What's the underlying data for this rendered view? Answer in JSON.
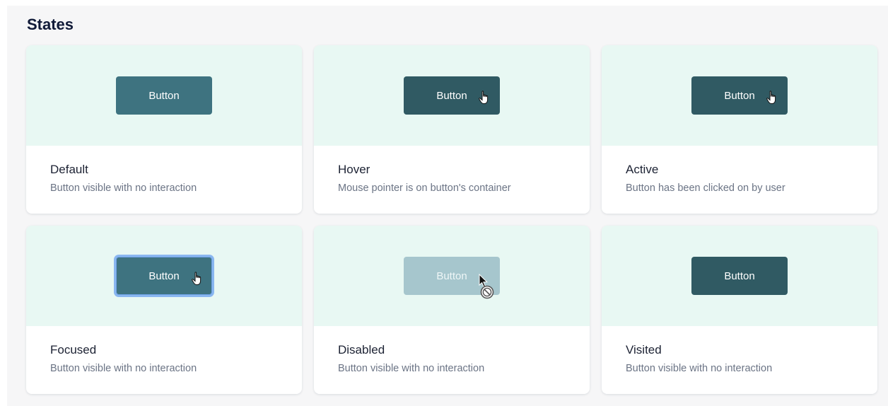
{
  "section": {
    "title": "States"
  },
  "states": [
    {
      "id": "default",
      "button_label": "Button",
      "title": "Default",
      "description": "Button visible with no interaction"
    },
    {
      "id": "hover",
      "button_label": "Button",
      "title": "Hover",
      "description": "Mouse pointer is on button's container"
    },
    {
      "id": "active",
      "button_label": "Button",
      "title": "Active",
      "description": "Button has been clicked on by user"
    },
    {
      "id": "focused",
      "button_label": "Button",
      "title": "Focused",
      "description": "Button visible with no interaction"
    },
    {
      "id": "disabled",
      "button_label": "Button",
      "title": "Disabled",
      "description": "Button visible with no interaction"
    },
    {
      "id": "visited",
      "button_label": "Button",
      "title": "Visited",
      "description": "Button visible with no interaction"
    }
  ],
  "colors": {
    "preview_background": "#e8f8f3",
    "button_default": "#3e7380",
    "button_dark": "#305a63",
    "button_disabled": "#a6c6cd",
    "focus_ring": "#8ab7f0"
  },
  "icons": {
    "pointer": "hand-pointer-icon",
    "arrow": "arrow-cursor-icon",
    "not_allowed": "not-allowed-icon"
  }
}
